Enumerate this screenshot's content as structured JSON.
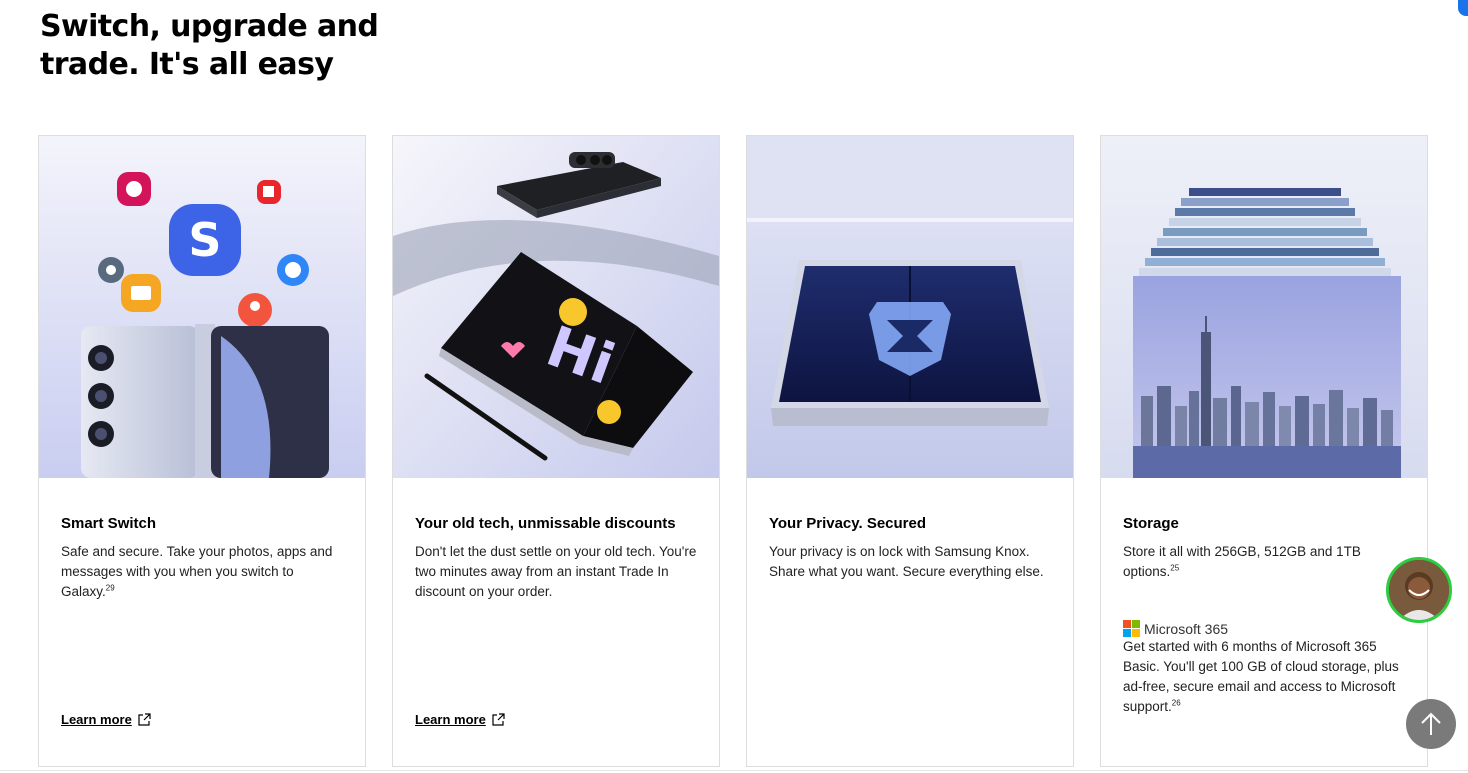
{
  "section": {
    "title": "Switch, upgrade and trade. It's all easy"
  },
  "cards": [
    {
      "title": "Smart Switch",
      "text": "Safe and secure. Take your photos, apps and messages with you when you switch to Galaxy.",
      "sup": "29",
      "link": "Learn more"
    },
    {
      "title": "Your old tech, unmissable discounts",
      "text": "Don't let the dust settle on your old tech. You're two minutes away from an instant Trade In discount on your order.",
      "link": "Learn more"
    },
    {
      "title": "Your Privacy. Secured",
      "text": "Your privacy is on lock with Samsung Knox. Share what you want. Secure everything else."
    },
    {
      "title": "Storage",
      "text": "Store it all with 256GB, 512GB and 1TB options.",
      "sup": "25",
      "brand": "Microsoft 365",
      "brand_text": "Get started with 6 months of Microsoft 365 Basic. You'll get 100 GB of cloud storage, plus ad-free, secure email and access to Microsoft support.",
      "brand_sup": "26"
    }
  ],
  "icons": {
    "external": "external-link-icon",
    "scroll_top": "arrow-up-icon",
    "chat": "chat-agent-avatar"
  },
  "colors": {
    "ms_red": "#f25022",
    "ms_green": "#7fba00",
    "ms_blue": "#00a4ef",
    "ms_yellow": "#ffb900",
    "avatar_ring": "#2ecc40"
  }
}
